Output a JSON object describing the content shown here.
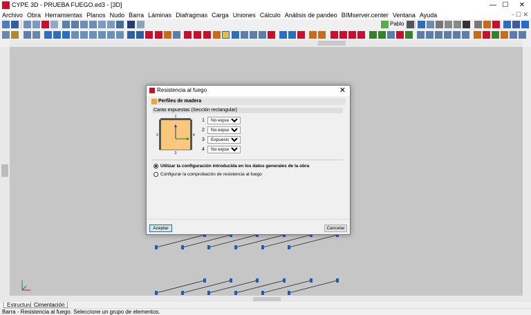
{
  "window": {
    "title": "CYPE 3D - PRUEBA FUEGO.ed3 - [3D]",
    "min": "—",
    "max": "☐",
    "close": "✕"
  },
  "menu": {
    "items": [
      "Archivo",
      "Obra",
      "Herramientas",
      "Planos",
      "Nudo",
      "Barra",
      "Láminas",
      "Diafragmas",
      "Carga",
      "Uniones",
      "Cálculo",
      "Análisis de pandeo",
      "BIMserver.center",
      "Ventana",
      "Ayuda"
    ],
    "mdi": "- ☐ ✕"
  },
  "toolbar": {
    "user": "Pablo"
  },
  "tabs": [
    "Estructura",
    "Cimentación"
  ],
  "status": "Barra - Resistencia al fuego. Seleccione un grupo de elementos.",
  "dialog": {
    "title": "Resistencia al fuego",
    "close": "✕",
    "section": "Perfiles de madera",
    "subheader": "Caras expuestas (Sección rectangular)",
    "faces": [
      {
        "num": "1",
        "value": "No expuesta"
      },
      {
        "num": "2",
        "value": "No expuesta"
      },
      {
        "num": "3",
        "value": "Expuesta"
      },
      {
        "num": "4",
        "value": "No expuesta"
      }
    ],
    "options": [
      "No expuesta",
      "Expuesta"
    ],
    "drawing_labels": {
      "top": "1",
      "left": "2",
      "bottom": "3",
      "right": "4"
    },
    "radio1": "Utilizar la configuración introducida en los datos generales de la obra",
    "radio2": "Configurar la comprobación de resistencia al fuego",
    "radio_selected": 1,
    "ok": "Aceptar",
    "cancel": "Cancelar"
  },
  "colors": {
    "accent": "#0078d7",
    "section_fill": "#fbc77c",
    "member": "#1a5fb4"
  }
}
